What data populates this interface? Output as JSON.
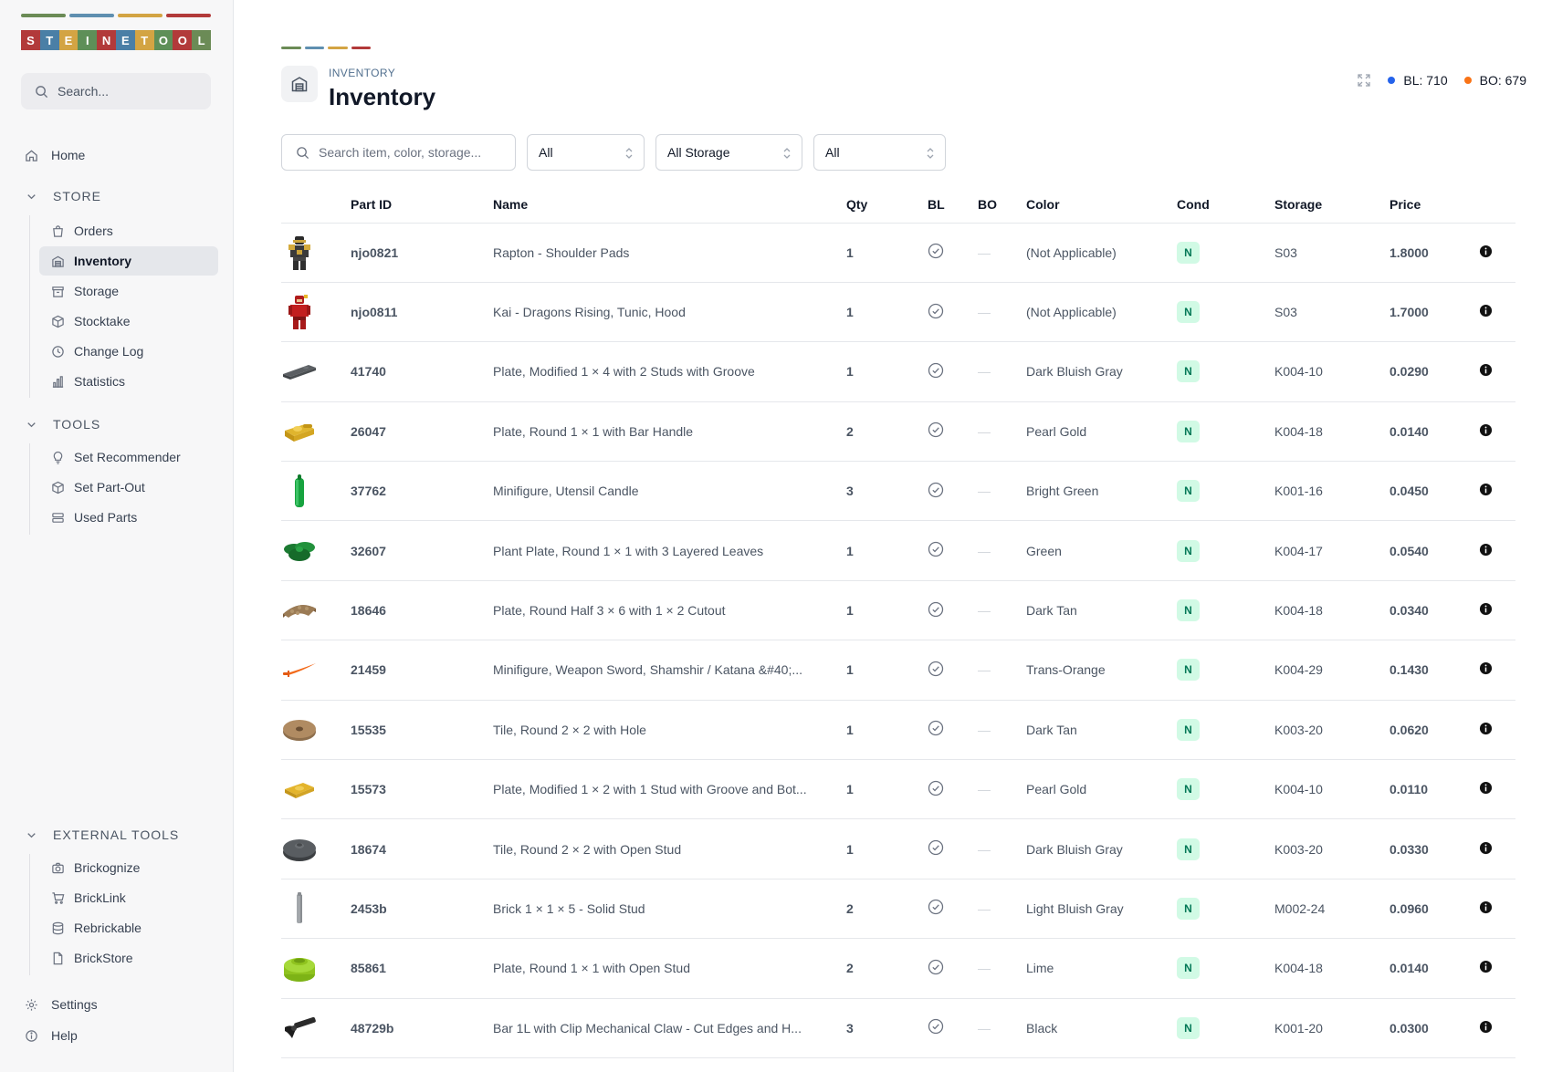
{
  "brand": {
    "letters": [
      "S",
      "T",
      "E",
      "I",
      "N",
      "E",
      "T",
      "O",
      "O",
      "L"
    ],
    "letter_colors": [
      "#b23a3a",
      "#4a7fa6",
      "#d3a443",
      "#5e8f58",
      "#b23a3a",
      "#4a7fa6",
      "#d3a443",
      "#5e8f58",
      "#b23a3a",
      "#6b8b56"
    ],
    "stripe_colors": [
      "#6b8b56",
      "#5f8fb0",
      "#d3a443",
      "#b23a3a"
    ]
  },
  "sidebar": {
    "search_placeholder": "Search...",
    "home": "Home",
    "store": {
      "title": "STORE",
      "items": [
        "Orders",
        "Inventory",
        "Storage",
        "Stocktake",
        "Change Log",
        "Statistics"
      ]
    },
    "tools": {
      "title": "TOOLS",
      "items": [
        "Set Recommender",
        "Set Part-Out",
        "Used Parts"
      ]
    },
    "external": {
      "title": "EXTERNAL TOOLS",
      "items": [
        "Brickognize",
        "BrickLink",
        "Rebrickable",
        "BrickStore"
      ]
    },
    "settings": "Settings",
    "help": "Help"
  },
  "header": {
    "breadcrumb": "INVENTORY",
    "title": "Inventory",
    "bl_label": "BL: 710",
    "bo_label": "BO: 679",
    "bl_color": "#2563eb",
    "bo_color": "#f97316"
  },
  "filters": {
    "search_placeholder": "Search item, color, storage...",
    "cond_value": "All",
    "storage_value": "All Storage",
    "third_value": "All"
  },
  "table": {
    "columns": [
      "Part ID",
      "Name",
      "Qty",
      "BL",
      "BO",
      "Color",
      "Cond",
      "Storage",
      "Price"
    ],
    "rows": [
      {
        "part_id": "njo0821",
        "name": "Rapton - Shoulder Pads",
        "qty": "1",
        "color": "(Not Applicable)",
        "cond": "N",
        "storage": "S03",
        "price": "1.8000",
        "thumb": "minifig-gold"
      },
      {
        "part_id": "njo0811",
        "name": "Kai - Dragons Rising, Tunic, Hood",
        "qty": "1",
        "color": "(Not Applicable)",
        "cond": "N",
        "storage": "S03",
        "price": "1.7000",
        "thumb": "minifig-red"
      },
      {
        "part_id": "41740",
        "name": "Plate, Modified 1 × 4 with 2 Studs with Groove",
        "qty": "1",
        "color": "Dark Bluish Gray",
        "cond": "N",
        "storage": "K004-10",
        "price": "0.0290",
        "thumb": "plate-gray"
      },
      {
        "part_id": "26047",
        "name": "Plate, Round 1 × 1 with Bar Handle",
        "qty": "2",
        "color": "Pearl Gold",
        "cond": "N",
        "storage": "K004-18",
        "price": "0.0140",
        "thumb": "gold-handle"
      },
      {
        "part_id": "37762",
        "name": "Minifigure, Utensil Candle",
        "qty": "3",
        "color": "Bright Green",
        "cond": "N",
        "storage": "K001-16",
        "price": "0.0450",
        "thumb": "candle"
      },
      {
        "part_id": "32607",
        "name": "Plant Plate, Round 1 × 1 with 3 Layered Leaves",
        "qty": "1",
        "color": "Green",
        "cond": "N",
        "storage": "K004-17",
        "price": "0.0540",
        "thumb": "leaves"
      },
      {
        "part_id": "18646",
        "name": "Plate, Round Half 3 × 6 with 1 × 2 Cutout",
        "qty": "1",
        "color": "Dark Tan",
        "cond": "N",
        "storage": "K004-18",
        "price": "0.0340",
        "thumb": "half-plate"
      },
      {
        "part_id": "21459",
        "name": "Minifigure, Weapon Sword, Shamshir / Katana &#40;...",
        "qty": "1",
        "color": "Trans-Orange",
        "cond": "N",
        "storage": "K004-29",
        "price": "0.1430",
        "thumb": "sword"
      },
      {
        "part_id": "15535",
        "name": "Tile, Round 2 × 2 with Hole",
        "qty": "1",
        "color": "Dark Tan",
        "cond": "N",
        "storage": "K003-20",
        "price": "0.0620",
        "thumb": "round-tile-tan"
      },
      {
        "part_id": "15573",
        "name": "Plate, Modified 1 × 2 with 1 Stud with Groove and Bot...",
        "qty": "1",
        "color": "Pearl Gold",
        "cond": "N",
        "storage": "K004-10",
        "price": "0.0110",
        "thumb": "jumper-gold"
      },
      {
        "part_id": "18674",
        "name": "Tile, Round 2 × 2 with Open Stud",
        "qty": "1",
        "color": "Dark Bluish Gray",
        "cond": "N",
        "storage": "K003-20",
        "price": "0.0330",
        "thumb": "round-tile-gray"
      },
      {
        "part_id": "2453b",
        "name": "Brick 1 × 1 × 5 - Solid Stud",
        "qty": "2",
        "color": "Light Bluish Gray",
        "cond": "N",
        "storage": "M002-24",
        "price": "0.0960",
        "thumb": "pillar"
      },
      {
        "part_id": "85861",
        "name": "Plate, Round 1 × 1 with Open Stud",
        "qty": "2",
        "color": "Lime",
        "cond": "N",
        "storage": "K004-18",
        "price": "0.0140",
        "thumb": "round-lime"
      },
      {
        "part_id": "48729b",
        "name": "Bar 1L with Clip Mechanical Claw - Cut Edges and H...",
        "qty": "3",
        "color": "Black",
        "cond": "N",
        "storage": "K001-20",
        "price": "0.0300",
        "thumb": "claw"
      }
    ]
  }
}
